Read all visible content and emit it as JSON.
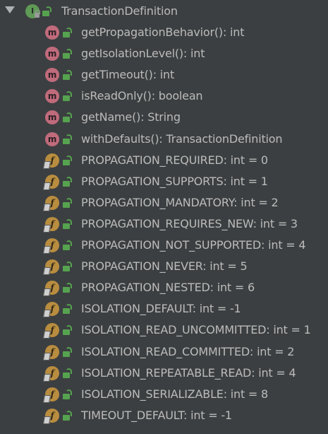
{
  "tree": {
    "root": {
      "icon": "interface-icon",
      "icon_letter": "I",
      "access": "public-lock-icon",
      "label": "TransactionDefinition",
      "expanded": true
    },
    "items": [
      {
        "kind": "method",
        "icon": "method-icon",
        "icon_letter": "m",
        "access": "public-lock-icon",
        "label": "getPropagationBehavior(): int"
      },
      {
        "kind": "method",
        "icon": "method-icon",
        "icon_letter": "m",
        "access": "public-lock-icon",
        "label": "getIsolationLevel(): int"
      },
      {
        "kind": "method",
        "icon": "method-icon",
        "icon_letter": "m",
        "access": "public-lock-icon",
        "label": "getTimeout(): int"
      },
      {
        "kind": "method",
        "icon": "method-icon",
        "icon_letter": "m",
        "access": "public-lock-icon",
        "label": "isReadOnly(): boolean"
      },
      {
        "kind": "method",
        "icon": "method-icon",
        "icon_letter": "m",
        "access": "public-lock-icon",
        "label": "getName(): String"
      },
      {
        "kind": "static-method",
        "icon": "static-method-icon",
        "icon_letter": "m",
        "access": "public-lock-icon",
        "label": "withDefaults(): TransactionDefinition"
      },
      {
        "kind": "field",
        "icon": "static-final-field-icon",
        "icon_letter": "f",
        "access": "public-lock-icon",
        "label": "PROPAGATION_REQUIRED: int = 0"
      },
      {
        "kind": "field",
        "icon": "static-final-field-icon",
        "icon_letter": "f",
        "access": "public-lock-icon",
        "label": "PROPAGATION_SUPPORTS: int = 1"
      },
      {
        "kind": "field",
        "icon": "static-final-field-icon",
        "icon_letter": "f",
        "access": "public-lock-icon",
        "label": "PROPAGATION_MANDATORY: int = 2"
      },
      {
        "kind": "field",
        "icon": "static-final-field-icon",
        "icon_letter": "f",
        "access": "public-lock-icon",
        "label": "PROPAGATION_REQUIRES_NEW: int = 3"
      },
      {
        "kind": "field",
        "icon": "static-final-field-icon",
        "icon_letter": "f",
        "access": "public-lock-icon",
        "label": "PROPAGATION_NOT_SUPPORTED: int = 4"
      },
      {
        "kind": "field",
        "icon": "static-final-field-icon",
        "icon_letter": "f",
        "access": "public-lock-icon",
        "label": "PROPAGATION_NEVER: int = 5"
      },
      {
        "kind": "field",
        "icon": "static-final-field-icon",
        "icon_letter": "f",
        "access": "public-lock-icon",
        "label": "PROPAGATION_NESTED: int = 6"
      },
      {
        "kind": "field",
        "icon": "static-final-field-icon",
        "icon_letter": "f",
        "access": "public-lock-icon",
        "label": "ISOLATION_DEFAULT: int = -1"
      },
      {
        "kind": "field",
        "icon": "static-final-field-icon",
        "icon_letter": "f",
        "access": "public-lock-icon",
        "label": "ISOLATION_READ_UNCOMMITTED: int = 1"
      },
      {
        "kind": "field",
        "icon": "static-final-field-icon",
        "icon_letter": "f",
        "access": "public-lock-icon",
        "label": "ISOLATION_READ_COMMITTED: int = 2"
      },
      {
        "kind": "field",
        "icon": "static-final-field-icon",
        "icon_letter": "f",
        "access": "public-lock-icon",
        "label": "ISOLATION_REPEATABLE_READ: int = 4"
      },
      {
        "kind": "field",
        "icon": "static-final-field-icon",
        "icon_letter": "f",
        "access": "public-lock-icon",
        "label": "ISOLATION_SERIALIZABLE: int = 8"
      },
      {
        "kind": "field",
        "icon": "static-final-field-icon",
        "icon_letter": "f",
        "access": "public-lock-icon",
        "label": "TIMEOUT_DEFAULT: int = -1"
      }
    ]
  },
  "colors": {
    "background": "#3c3f41",
    "text": "#bbbbbb",
    "interface_icon": "#5f9a57",
    "method_icon": "#c06b7c",
    "field_icon": "#b98d3f",
    "public_access": "#56a34f",
    "expand_arrow": "#aeb0b2"
  }
}
